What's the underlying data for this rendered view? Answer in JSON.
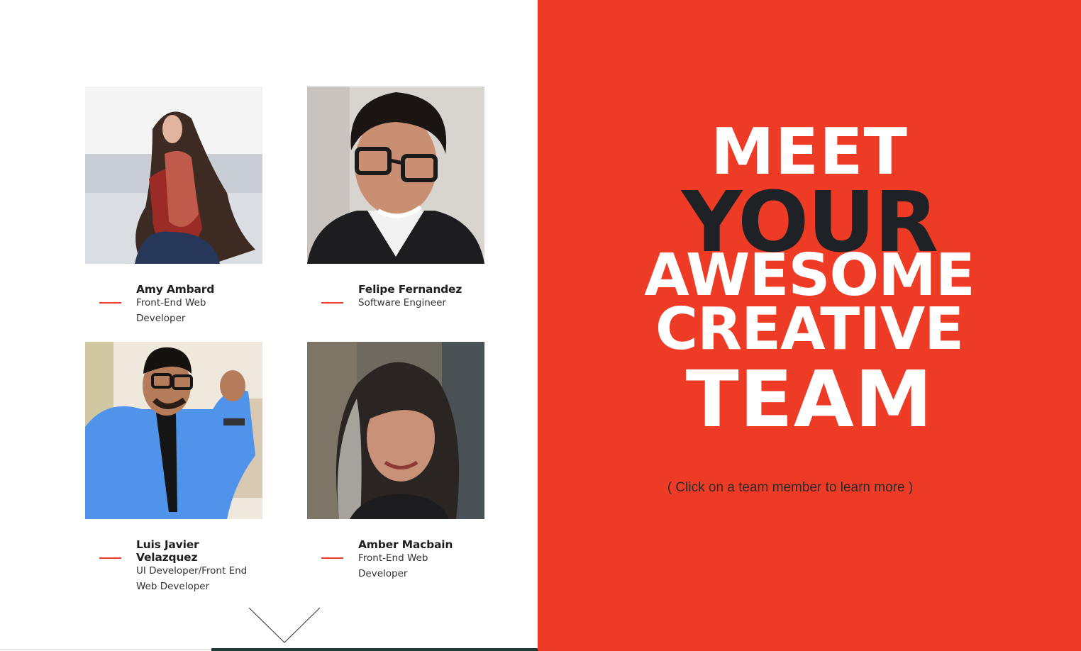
{
  "headline": {
    "line1": "MEET",
    "line2": "YOUR",
    "line3": "AWESOME",
    "line4": "CREATIVE",
    "line5": "TEAM"
  },
  "hint": "( Click on a team member to learn more )",
  "team": [
    {
      "name": "Amy Ambard",
      "role": "Front-End Web Developer"
    },
    {
      "name": "Felipe Fernandez",
      "role": "Software Engineer"
    },
    {
      "name": "Luis Javier Velazquez",
      "role": "UI Developer/Front End Web Developer"
    },
    {
      "name": "Amber Macbain",
      "role": "Front-End Web Developer"
    }
  ],
  "colors": {
    "accent": "#ee3b25",
    "dark": "#1e2126",
    "white": "#ffffff"
  },
  "icons": {
    "scroll_down": "chevron-down-icon"
  }
}
